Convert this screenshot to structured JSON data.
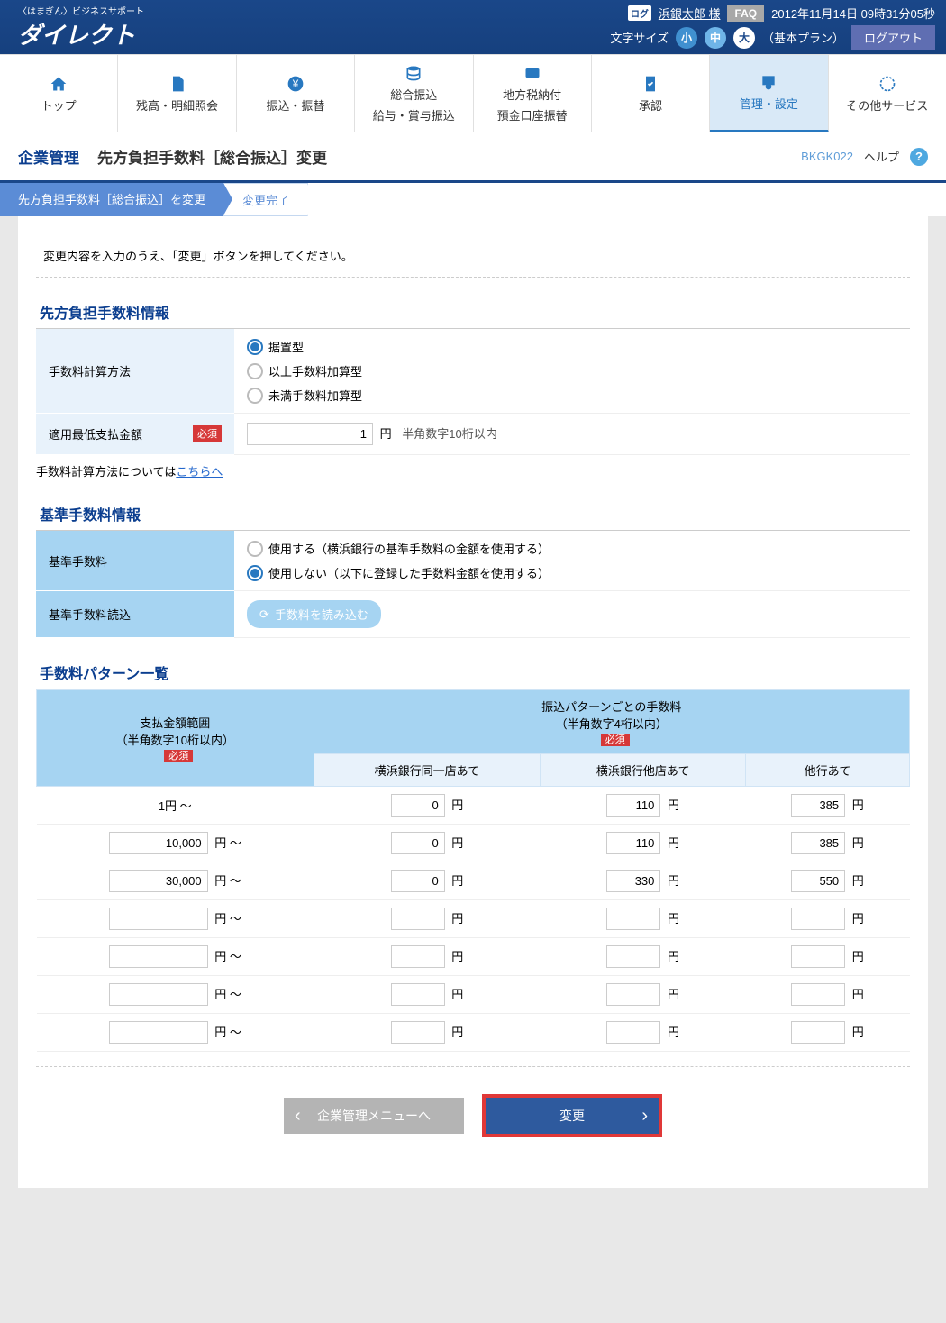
{
  "header": {
    "logo_small": "〈はまぎん〉ビジネスサポート",
    "logo_main": "ダイレクト",
    "user_icon": "ログ",
    "user_name": "浜銀太郎 様",
    "faq": "FAQ",
    "datetime": "2012年11月14日 09時31分05秒",
    "font_size_label": "文字サイズ",
    "size_s": "小",
    "size_m": "中",
    "size_l": "大",
    "plan": "（基本プラン）",
    "logout": "ログアウト"
  },
  "nav": [
    {
      "label": "トップ"
    },
    {
      "label": "残高・明細照会"
    },
    {
      "label": "振込・振替"
    },
    {
      "label1": "総合振込",
      "label2": "給与・賞与振込"
    },
    {
      "label1": "地方税納付",
      "label2": "預金口座振替"
    },
    {
      "label": "承認"
    },
    {
      "label": "管理・設定"
    },
    {
      "label": "その他サービス"
    }
  ],
  "page": {
    "category": "企業管理",
    "title": "先方負担手数料［総合振込］変更",
    "code": "BKGK022",
    "help": "ヘルプ",
    "help_icon": "?"
  },
  "steps": {
    "s1": "先方負担手数料［総合振込］を変更",
    "s2": "変更完了"
  },
  "intro": "変更内容を入力のうえ、「変更」ボタンを押してください。",
  "section1": {
    "title": "先方負担手数料情報",
    "row1_label": "手数料計算方法",
    "r1": "据置型",
    "r2": "以上手数料加算型",
    "r3": "未満手数料加算型",
    "row2_label": "適用最低支払金額",
    "req": "必須",
    "row2_value": "1",
    "row2_unit": "円",
    "row2_hint": "半角数字10桁以内",
    "note_prefix": "手数料計算方法については",
    "note_link": "こちらへ"
  },
  "section2": {
    "title": "基準手数料情報",
    "row1_label": "基準手数料",
    "r1": "使用する（横浜銀行の基準手数料の金額を使用する）",
    "r2": "使用しない（以下に登録した手数料金額を使用する）",
    "row2_label": "基準手数料読込",
    "load_btn": "手数料を読み込む"
  },
  "section3": {
    "title": "手数料パターン一覧",
    "col_range1": "支払金額範囲",
    "col_range2": "（半角数字10桁以内）",
    "col_fee1": "振込パターンごとの手数料",
    "col_fee2": "（半角数字4桁以内）",
    "req": "必須",
    "sub1": "横浜銀行同一店あて",
    "sub2": "横浜銀行他店あて",
    "sub3": "他行あて",
    "yen": "円",
    "range_suffix": "円 ～",
    "rows": [
      {
        "range_display": "1円 ～",
        "range": "",
        "fixed": true,
        "v1": "0",
        "v2": "110",
        "v3": "385"
      },
      {
        "range": "10,000",
        "v1": "0",
        "v2": "110",
        "v3": "385"
      },
      {
        "range": "30,000",
        "v1": "0",
        "v2": "330",
        "v3": "550"
      },
      {
        "range": "",
        "v1": "",
        "v2": "",
        "v3": ""
      },
      {
        "range": "",
        "v1": "",
        "v2": "",
        "v3": ""
      },
      {
        "range": "",
        "v1": "",
        "v2": "",
        "v3": ""
      },
      {
        "range": "",
        "v1": "",
        "v2": "",
        "v3": ""
      }
    ]
  },
  "buttons": {
    "back": "企業管理メニューへ",
    "submit": "変更"
  }
}
